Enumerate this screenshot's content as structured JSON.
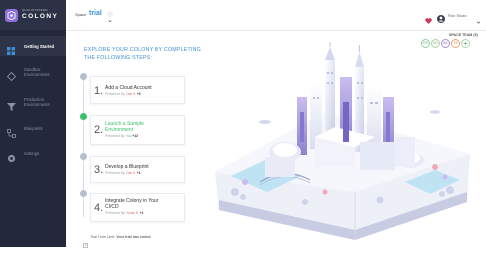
{
  "app": {
    "logo_small": "QUALISYSTEMS",
    "logo_text": "COLONY"
  },
  "sidebar": {
    "items": [
      {
        "label": "Getting Started",
        "icon": "grid-icon",
        "active": true
      },
      {
        "label": "Sandbox Environments",
        "icon": "diamond-icon",
        "active": false
      },
      {
        "label": "Production Environments",
        "icon": "funnel-icon",
        "active": false
      },
      {
        "label": "Blueprints",
        "icon": "blueprint-icon",
        "active": false
      },
      {
        "label": "Settings",
        "icon": "gear-icon",
        "active": false
      }
    ]
  },
  "topbar": {
    "space_label": "Space",
    "space_name": "trial",
    "user_name": "Ron Sloan"
  },
  "team": {
    "label": "SPACE TEAM (9)",
    "avatars": [
      "RS",
      "MJ",
      "AK",
      "TS"
    ]
  },
  "main": {
    "heading_line1": "EXPLORE YOUR COLONY BY COMPLETING",
    "heading_line2": "THE FOLLOWING STEPS:",
    "steps": [
      {
        "num": "1.",
        "title1": "Add a Cloud Account",
        "title2": "",
        "performed_by": "Performed By:",
        "who": "Dan S.",
        "plus": "+3",
        "done": false
      },
      {
        "num": "2.",
        "title1": "Launch a Sample",
        "title2": "Environment",
        "performed_by": "Performed By:",
        "who": "You",
        "plus": "+12",
        "done": true
      },
      {
        "num": "3.",
        "title1": "Develop a Blueprint",
        "title2": "",
        "performed_by": "Performed By:",
        "who": "Dan S.",
        "plus": "+1",
        "done": false
      },
      {
        "num": "4.",
        "title1": "Integrate Colony in Your",
        "title2": "CI/CD",
        "performed_by": "Performed By:",
        "who": "Yonan E.",
        "plus": "+1",
        "done": false
      }
    ],
    "trial_label": "Trial Time Limit:",
    "trial_value": "Your trial has ended"
  },
  "colors": {
    "accent": "#3f8fd6",
    "sidebar_bg": "#23283a",
    "done": "#3cc06a",
    "pending": "#b8bfcc",
    "heart": "#d6365d"
  }
}
